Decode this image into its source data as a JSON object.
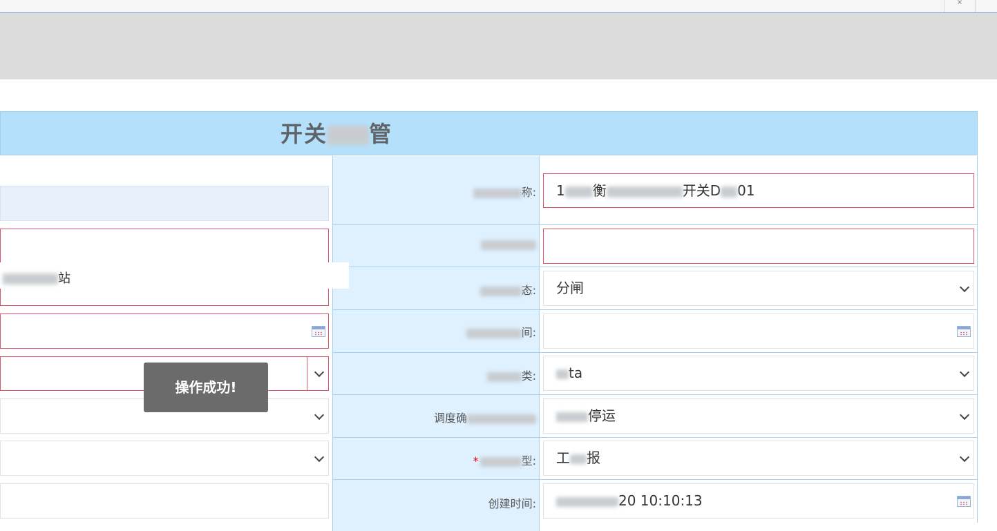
{
  "tab": {
    "close_glyph": "×"
  },
  "form": {
    "title_visible": "开关",
    "title_end": "管",
    "left": {
      "station_text": "站",
      "row5_select_value": "",
      "row6_select_value": "",
      "row7_select_value": "",
      "row8_input_value": ""
    },
    "right": {
      "name_label_tail": "称:",
      "name_value_start": "1",
      "name_value_end": "01",
      "name_value_mid_a": "衡",
      "name_value_mid_b": "开关D",
      "row2_value": "",
      "row3_label_tail": "态:",
      "row3_value": "分闸",
      "row4_label_tail": "间:",
      "row4_value": "",
      "row5_label_tail": "类:",
      "row5_value": "ta",
      "row6_label": "调度确",
      "row6_value": "停运",
      "row7_required": "*",
      "row7_label_tail": "型:",
      "row7_value_a": "工",
      "row7_value_b": "报",
      "row8_label": "创建时间:",
      "row8_value": "20 10:10:13"
    }
  },
  "toast": {
    "message": "操作成功!"
  },
  "icons": {
    "calendar": "calendar-icon",
    "dropdown": "chevron-down-icon"
  },
  "colors": {
    "title_bar": "#b5e0fc",
    "label_column": "#dff1ff",
    "invalid_border": "#d9546b",
    "toast_bg": "#6b6b6b"
  }
}
